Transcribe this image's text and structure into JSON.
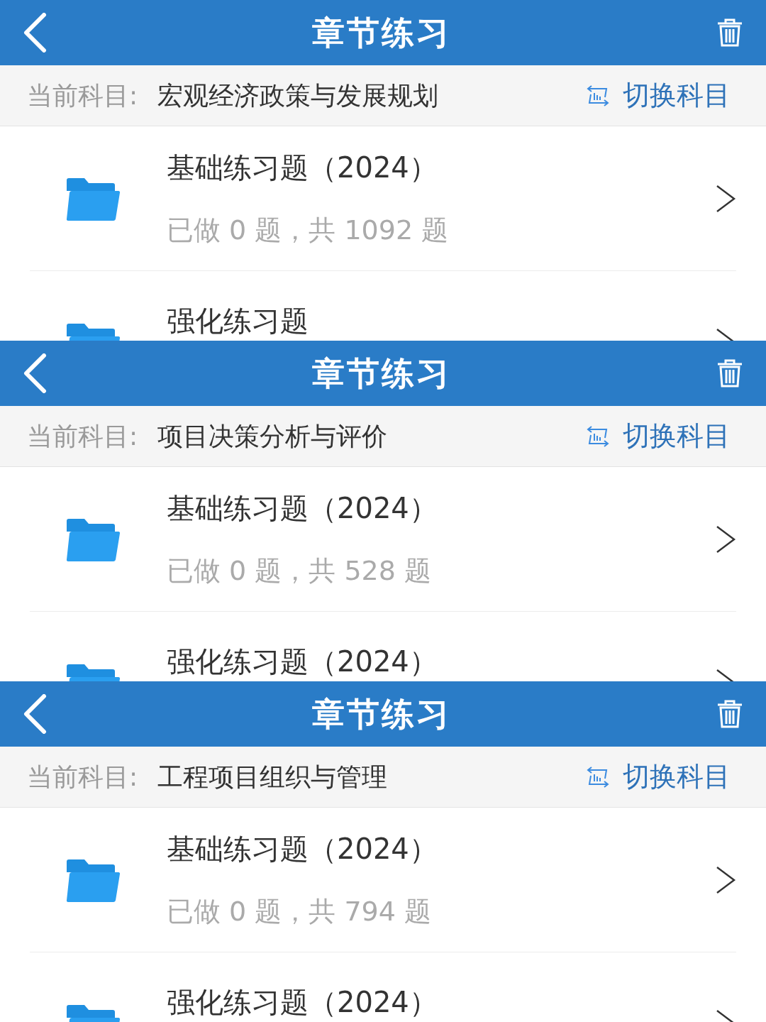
{
  "panels": [
    {
      "title": "章节练习",
      "subject_label": "当前科目:",
      "subject": "宏观经济政策与发展规划",
      "switch_label": "切换科目",
      "items": [
        {
          "title": "基础练习题（2024）",
          "progress": "已做 0 题，共 1092 题"
        },
        {
          "title": "强化练习题"
        }
      ]
    },
    {
      "title": "章节练习",
      "subject_label": "当前科目:",
      "subject": "项目决策分析与评价",
      "switch_label": "切换科目",
      "items": [
        {
          "title": "基础练习题（2024）",
          "progress": "已做 0 题，共 528 题"
        },
        {
          "title": "强化练习题（2024）"
        }
      ]
    },
    {
      "title": "章节练习",
      "subject_label": "当前科目:",
      "subject": "工程项目组织与管理",
      "switch_label": "切换科目",
      "items": [
        {
          "title": "基础练习题（2024）",
          "progress": "已做 0 题，共 794 题"
        },
        {
          "title": "强化练习题（2024）"
        }
      ]
    }
  ]
}
